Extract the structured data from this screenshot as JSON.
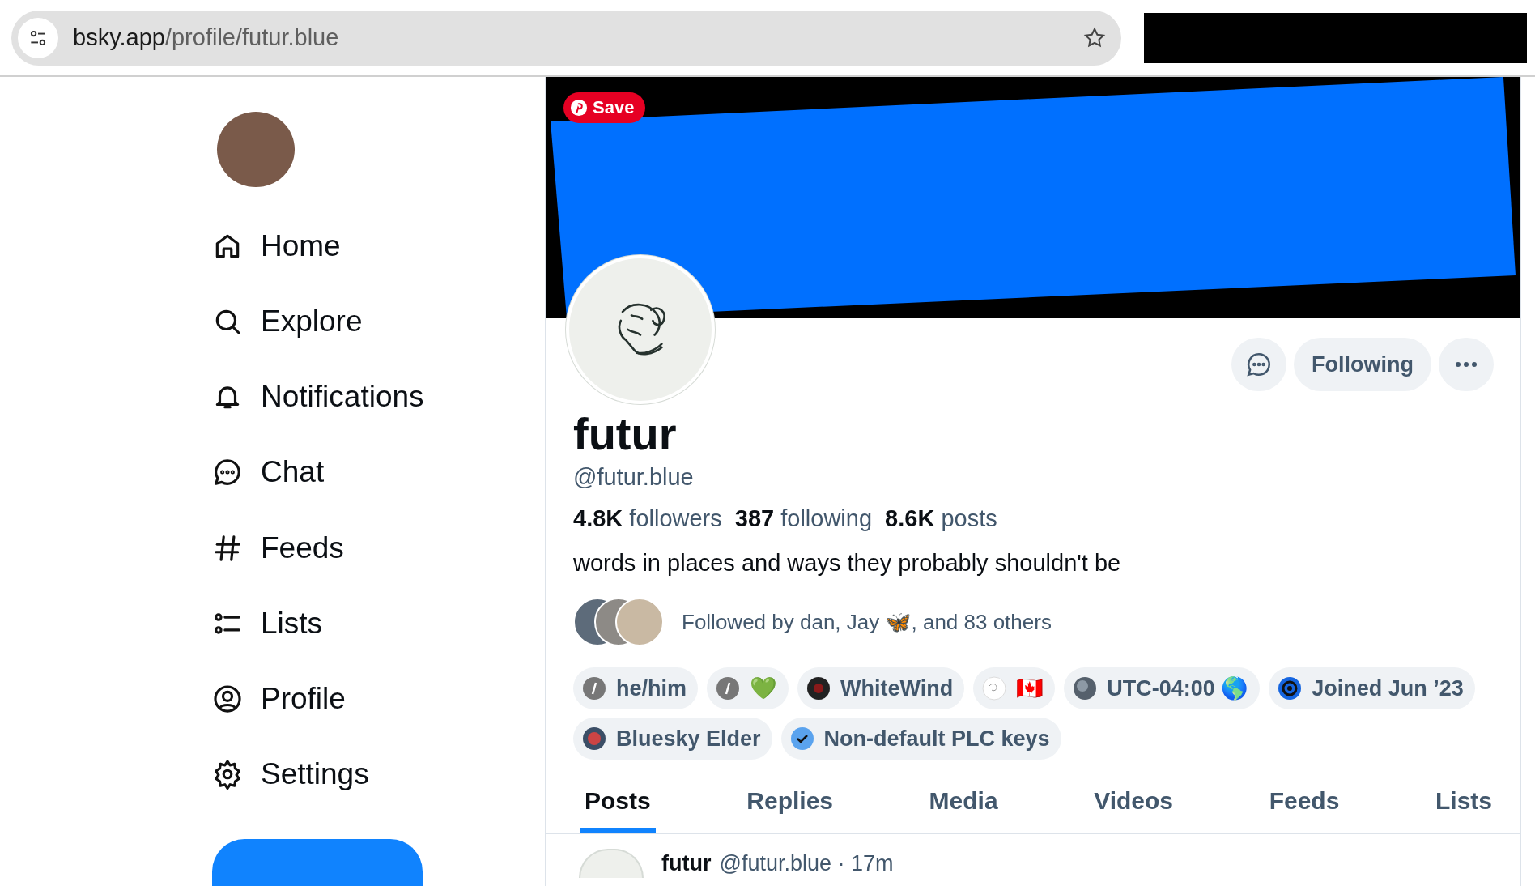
{
  "browser": {
    "url_host": "bsky.app",
    "url_path": "/profile/futur.blue"
  },
  "overlay": {
    "save_label": "Save"
  },
  "nav": {
    "items": [
      {
        "label": "Home",
        "kind": "home"
      },
      {
        "label": "Explore",
        "kind": "search"
      },
      {
        "label": "Notifications",
        "kind": "bell"
      },
      {
        "label": "Chat",
        "kind": "chat"
      },
      {
        "label": "Feeds",
        "kind": "hash"
      },
      {
        "label": "Lists",
        "kind": "lists"
      },
      {
        "label": "Profile",
        "kind": "person"
      },
      {
        "label": "Settings",
        "kind": "gear"
      }
    ]
  },
  "profile": {
    "follow_button": "Following",
    "display_name": "futur",
    "handle": "@futur.blue",
    "stats": [
      "**4.8K** followers",
      "**387** following",
      "**8.6K** posts"
    ],
    "bio": "words in places and ways they probably shouldn't be",
    "followed_by": "Followed by dan, Jay 🦋, and 83 others",
    "badges": [
      {
        "label": "he/him",
        "kind": "slash"
      },
      {
        "label": "💚",
        "kind": "slash"
      },
      {
        "label": "WhiteWind",
        "kind": "disc"
      },
      {
        "label": "🇨🇦",
        "kind": "sketch"
      },
      {
        "label": "UTC-04:00 🌎",
        "kind": "globe"
      },
      {
        "label": "Joined Jun ’23",
        "kind": "target"
      },
      {
        "label": "Bluesky Elder",
        "kind": "photo"
      },
      {
        "label": "Non-default PLC keys",
        "kind": "check"
      }
    ]
  },
  "tabs": [
    {
      "label": "Posts",
      "selected": true
    },
    {
      "label": "Replies",
      "selected": false
    },
    {
      "label": "Media",
      "selected": false
    },
    {
      "label": "Videos",
      "selected": false
    },
    {
      "label": "Feeds",
      "selected": false
    },
    {
      "label": "Lists",
      "selected": false
    }
  ],
  "post": {
    "author": "futur",
    "meta": "@futur.blue · 17m"
  }
}
